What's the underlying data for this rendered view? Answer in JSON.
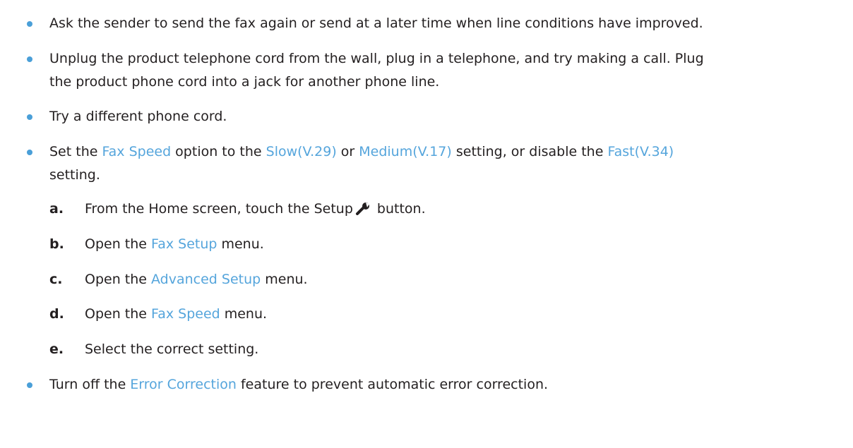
{
  "items": [
    {
      "text": "Ask the sender to send the fax again or send at a later time when line conditions have improved."
    },
    {
      "line1": "Unplug the product telephone cord from the wall, plug in a telephone, and try making a call. Plug",
      "line2": "the product phone cord into a jack for another phone line."
    },
    {
      "text": "Try a different phone cord."
    },
    {
      "t1": "Set the ",
      "fax_speed": "Fax Speed",
      "t2": " option to the ",
      "slow": "Slow(V.29)",
      "t3": " or ",
      "medium": "Medium(V.17)",
      "t4": " setting, or disable the ",
      "fast": "Fast(V.34)",
      "line2": "setting."
    },
    {
      "t1": "Turn off the ",
      "error_correction": "Error Correction",
      "t2": " feature to prevent automatic error correction."
    }
  ],
  "steps": [
    {
      "letter": "a.",
      "pre": "From the Home screen, touch the Setup",
      "post": " button.",
      "icon": "wrench-icon"
    },
    {
      "letter": "b.",
      "pre": "Open the ",
      "link": "Fax Setup",
      "post": " menu."
    },
    {
      "letter": "c.",
      "pre": "Open the ",
      "link": "Advanced Setup",
      "post": " menu."
    },
    {
      "letter": "d.",
      "pre": "Open the ",
      "link": "Fax Speed",
      "post": " menu."
    },
    {
      "letter": "e.",
      "pre": "Select the correct setting."
    }
  ],
  "colors": {
    "bullet": "#4a9fd8",
    "link": "#55a5dc",
    "text": "#231f20"
  }
}
